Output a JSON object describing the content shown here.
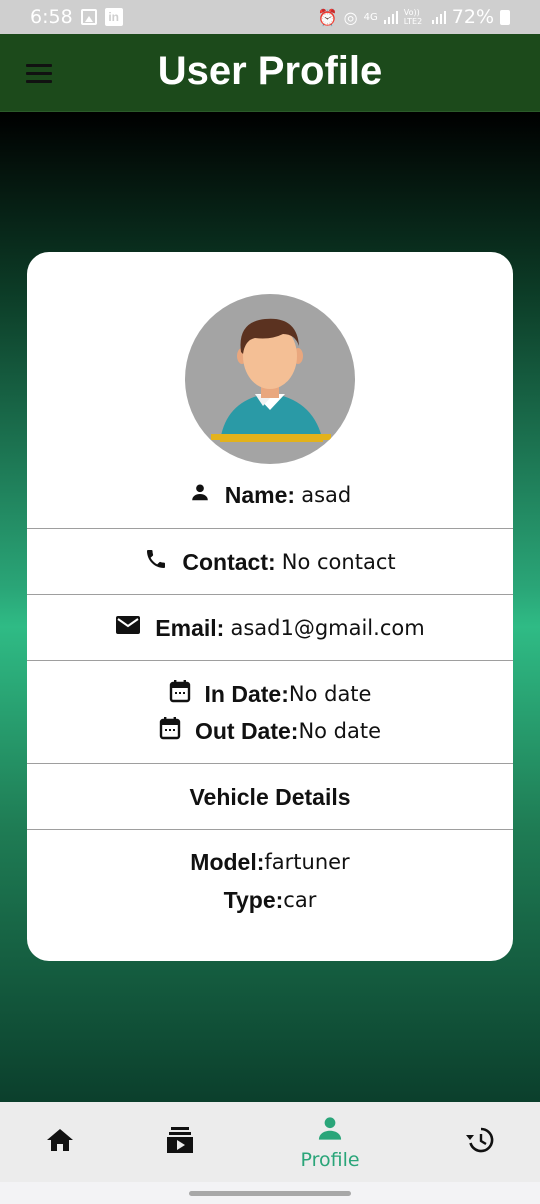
{
  "status_bar": {
    "time": "6:58",
    "network": "4G",
    "volte": "Vo)) LTE2",
    "battery": "72%"
  },
  "app_bar": {
    "title": "User Profile",
    "menu_icon": "hamburger-menu-icon"
  },
  "profile": {
    "avatar_icon": "user-avatar-illustration",
    "name_label": "Name:",
    "name_value": "asad",
    "contact_label": "Contact:",
    "contact_value": "No contact",
    "email_label": "Email:",
    "email_value": "asad1@gmail.com",
    "in_date_label": "In Date:",
    "in_date_value": "No date",
    "out_date_label": "Out Date:",
    "out_date_value": "No date",
    "vehicle_heading": "Vehicle Details",
    "model_label": "Model:",
    "model_value": "fartuner",
    "type_label": "Type:",
    "type_value": "car"
  },
  "bottom_nav": {
    "items": [
      {
        "icon": "home-icon",
        "label": ""
      },
      {
        "icon": "slideshow-icon",
        "label": ""
      },
      {
        "icon": "person-icon",
        "label": "Profile",
        "active": true
      },
      {
        "icon": "history-icon",
        "label": ""
      }
    ]
  },
  "colors": {
    "app_bar": "#1c4a1b",
    "accent": "#2aa579",
    "card": "#ffffff"
  }
}
